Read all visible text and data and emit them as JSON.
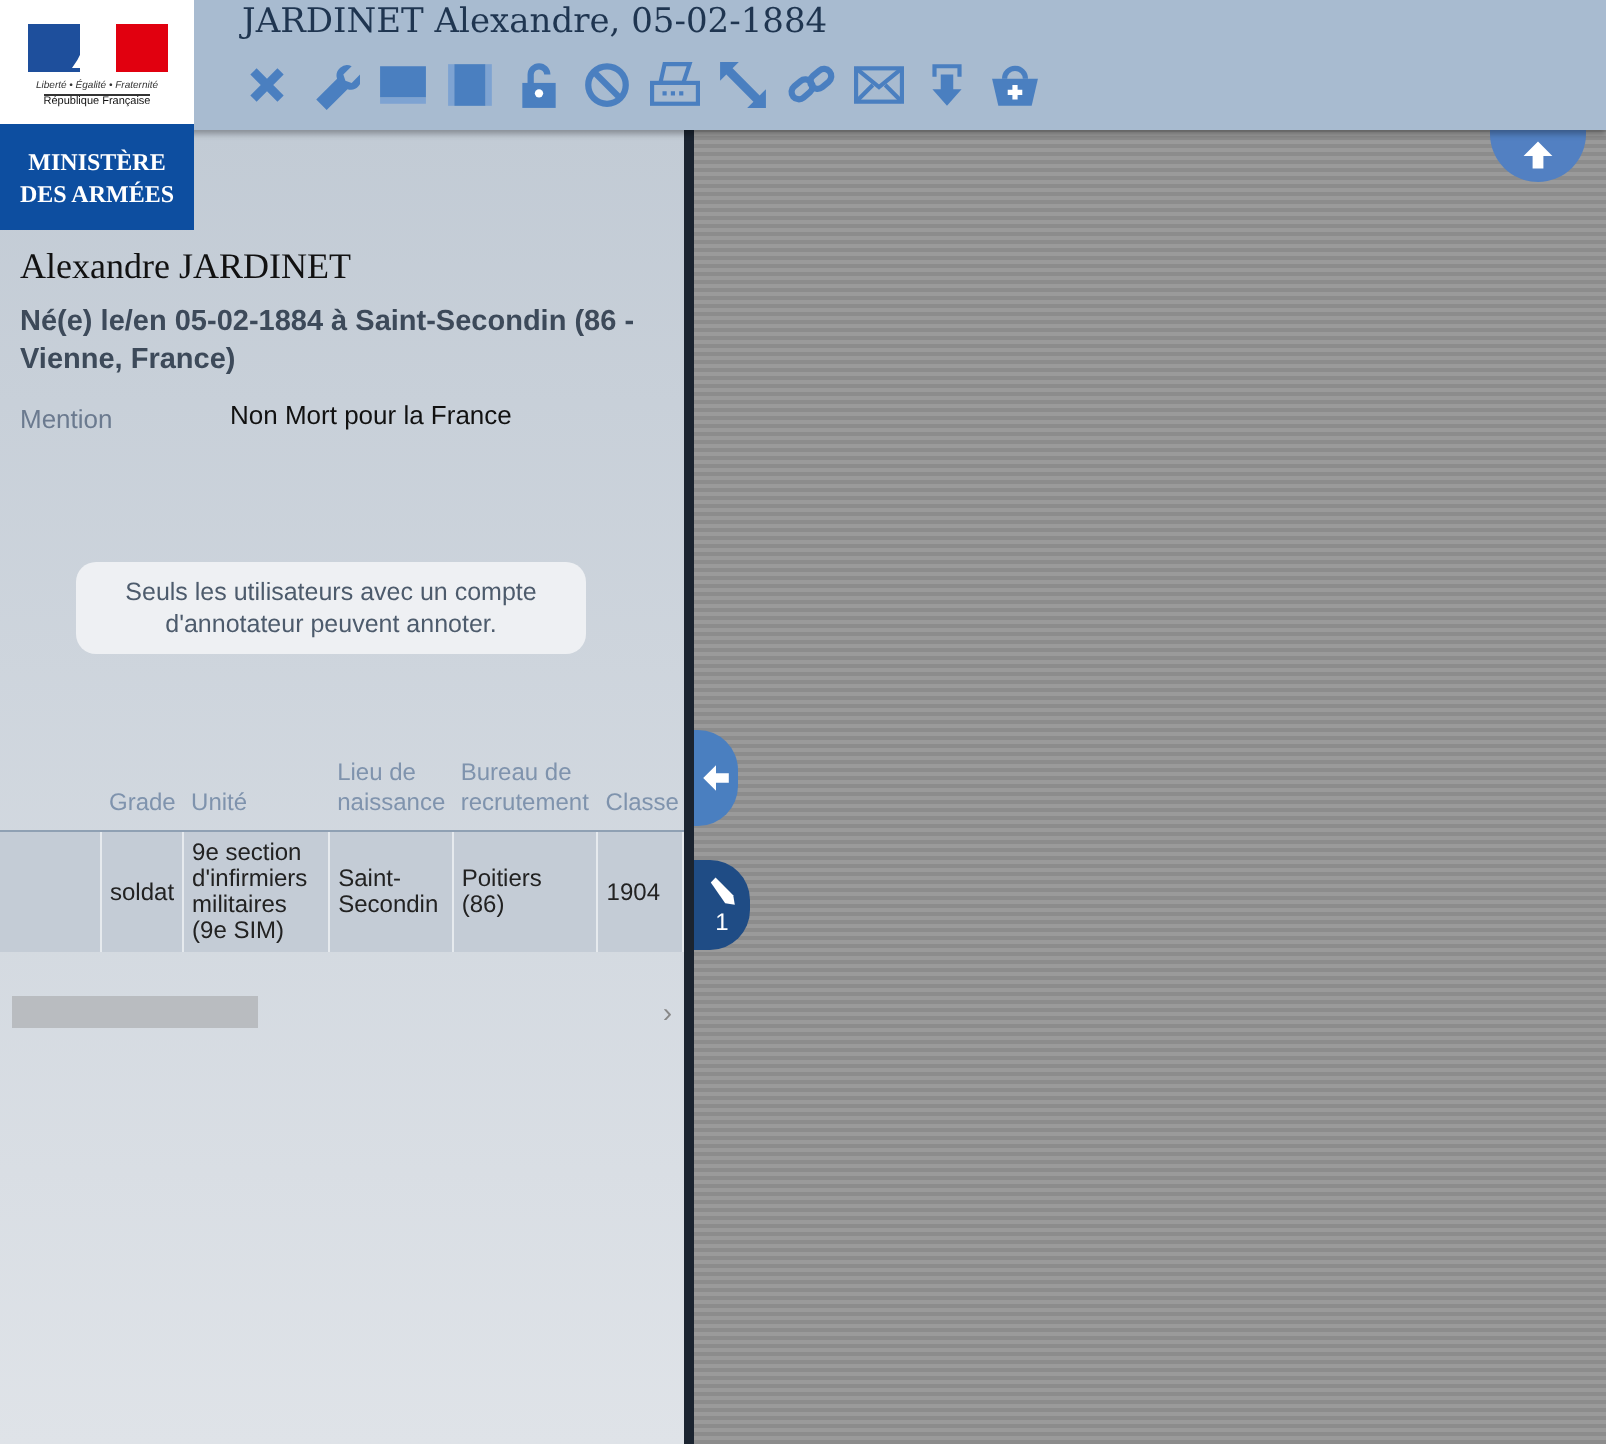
{
  "logo": {
    "motto": "Liberté • Égalité • Fraternité",
    "country": "République Française",
    "ministry": [
      "MINISTÈRE",
      "DES ARMÉES"
    ]
  },
  "header": {
    "title": "JARDINET Alexandre, 05-02-1884"
  },
  "record": {
    "name": "Alexandre JARDINET",
    "birth": "Né(e) le/en 05-02-1884 à Saint-Secondin (86 - Vienne, France)",
    "mention_label": "Mention",
    "mention_value": "Non Mort pour la France"
  },
  "notice": "Seuls les utilisateurs avec un compte d'annotateur peuvent annoter.",
  "table": {
    "columns": [
      "Grade",
      "Unité",
      "Lieu de naissance",
      "Bureau de recrutement",
      "Classe"
    ],
    "rows": [
      [
        "soldat",
        "9e section d'infirmiers militaires (9e SIM)",
        "Saint-Secondin",
        "Poitiers (86)",
        "1904"
      ]
    ]
  },
  "scroll_arrow": "›",
  "annotation_tab": {
    "count": "1"
  }
}
